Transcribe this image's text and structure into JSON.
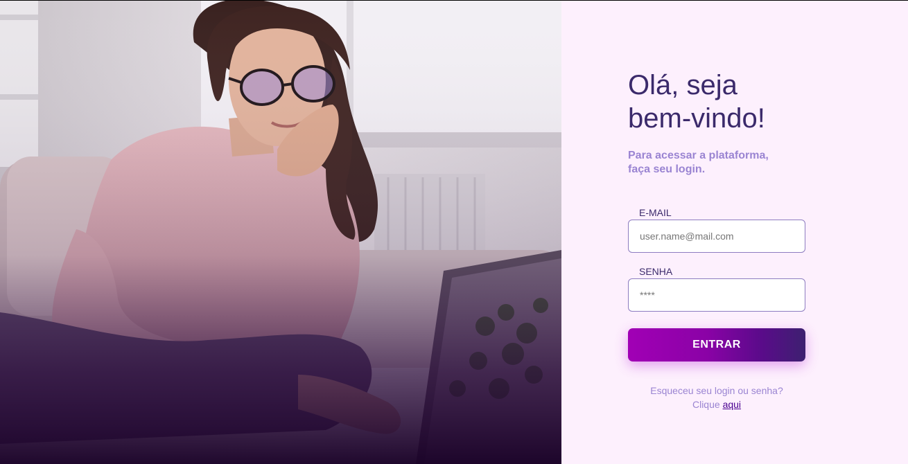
{
  "hero": {
    "image": "woman-with-glasses-using-laptop-photo"
  },
  "login": {
    "title_line1": "Olá, seja",
    "title_line2": "bem-vindo!",
    "subtitle_line1": "Para acessar a plataforma,",
    "subtitle_line2": "faça seu login.",
    "email_label": "E-MAIL",
    "email_placeholder": "user.name@mail.com",
    "password_label": "SENHA",
    "password_placeholder": "****",
    "submit_label": "ENTRAR",
    "forgot_line1": "Esqueceu seu login ou senha?",
    "forgot_line2_prefix": "Clique",
    "forgot_link": "aqui"
  },
  "colors": {
    "panel_bg": "#fdf0fd",
    "title": "#3b2a6b",
    "subtitle": "#9a84d2",
    "button_start": "#a100b5",
    "button_end": "#3d2070",
    "link": "#4a0090"
  }
}
